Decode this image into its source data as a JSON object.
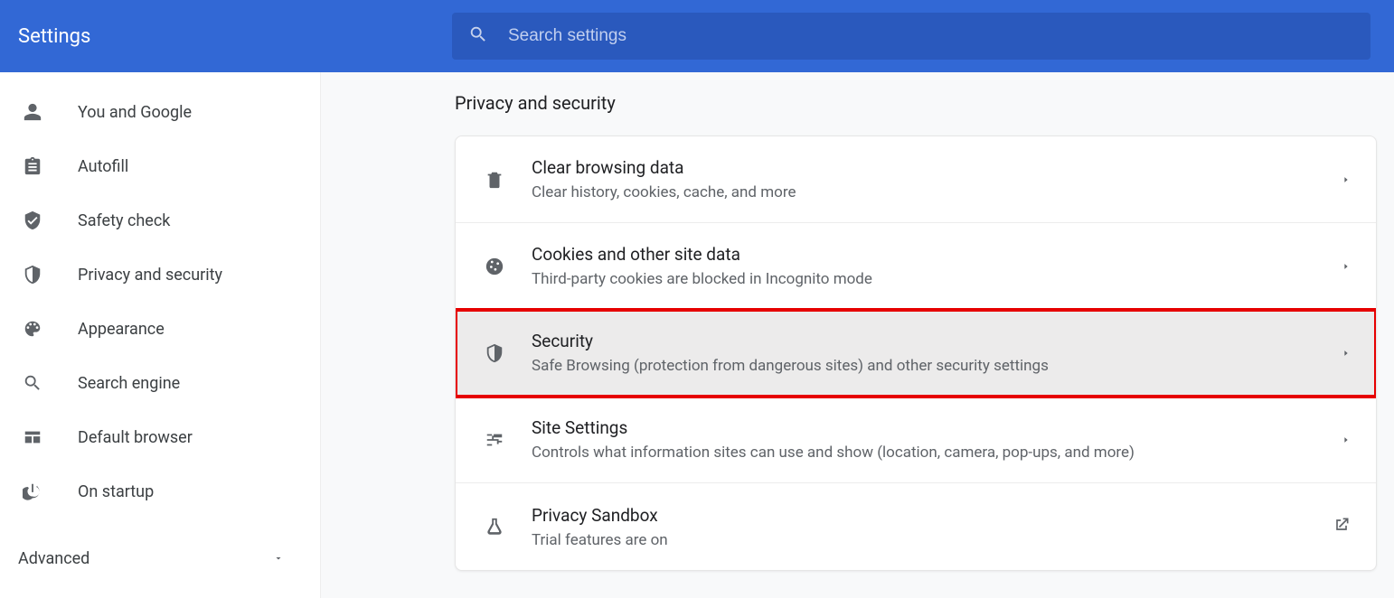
{
  "header": {
    "title": "Settings",
    "search_placeholder": "Search settings"
  },
  "sidebar": {
    "items": [
      {
        "label": "You and Google",
        "icon": "person"
      },
      {
        "label": "Autofill",
        "icon": "clipboard"
      },
      {
        "label": "Safety check",
        "icon": "shield-check"
      },
      {
        "label": "Privacy and security",
        "icon": "shield-half"
      },
      {
        "label": "Appearance",
        "icon": "palette"
      },
      {
        "label": "Search engine",
        "icon": "search"
      },
      {
        "label": "Default browser",
        "icon": "browser"
      },
      {
        "label": "On startup",
        "icon": "power"
      }
    ],
    "advanced_label": "Advanced"
  },
  "main": {
    "section_title": "Privacy and security",
    "rows": [
      {
        "title": "Clear browsing data",
        "sub": "Clear history, cookies, cache, and more",
        "icon": "trash",
        "arrow": "chevron"
      },
      {
        "title": "Cookies and other site data",
        "sub": "Third-party cookies are blocked in Incognito mode",
        "icon": "cookie",
        "arrow": "chevron"
      },
      {
        "title": "Security",
        "sub": "Safe Browsing (protection from dangerous sites) and other security settings",
        "icon": "shield-half",
        "arrow": "chevron",
        "highlight": true
      },
      {
        "title": "Site Settings",
        "sub": "Controls what information sites can use and show (location, camera, pop-ups, and more)",
        "icon": "sliders",
        "arrow": "chevron"
      },
      {
        "title": "Privacy Sandbox",
        "sub": "Trial features are on",
        "icon": "flask",
        "arrow": "external"
      }
    ]
  }
}
